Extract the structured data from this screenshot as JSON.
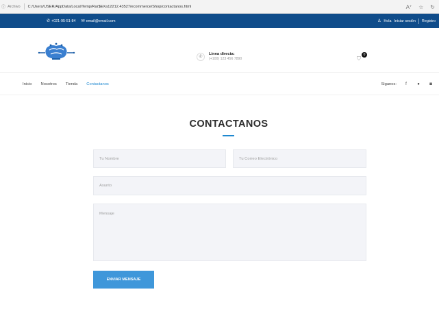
{
  "browser": {
    "info_label": "Archivo",
    "url": "C:/Users/USER/AppData/Local/Temp/Rar$EXa12212.43527/ecommerce/Shop/contactanos.html",
    "right_icons": [
      "read-aloud-icon",
      "star-icon",
      "refresh-icon"
    ]
  },
  "topbar": {
    "phone": "+021-95-51-84",
    "email": "email@email.com",
    "greeting": "Hola",
    "login": "Iniciar sesión",
    "register": "Registro"
  },
  "header": {
    "hotline_label": "Linea directa:",
    "hotline_number": "(+100) 123 456 7890",
    "cart_count": "0"
  },
  "nav": {
    "items": [
      {
        "label": "Inicio",
        "active": false
      },
      {
        "label": "Nosotros",
        "active": false
      },
      {
        "label": "Tienda",
        "active": false
      },
      {
        "label": "Contactanos",
        "active": true
      }
    ],
    "follow_label": "Siganos:",
    "social_icons": [
      "facebook-icon",
      "github-icon",
      "instagram-icon"
    ]
  },
  "contact": {
    "title": "CONTACTANOS",
    "name_placeholder": "Tu Nombre",
    "email_placeholder": "Tu Correo Electrónico",
    "subject_placeholder": "Asunto",
    "message_placeholder": "Mensaje",
    "send_label": "ENVIAR MENSAJE"
  },
  "colors": {
    "topbar": "#0f4c8a",
    "accent": "#1e88d0",
    "button": "#3f97da",
    "field_bg": "#f3f4f8"
  }
}
